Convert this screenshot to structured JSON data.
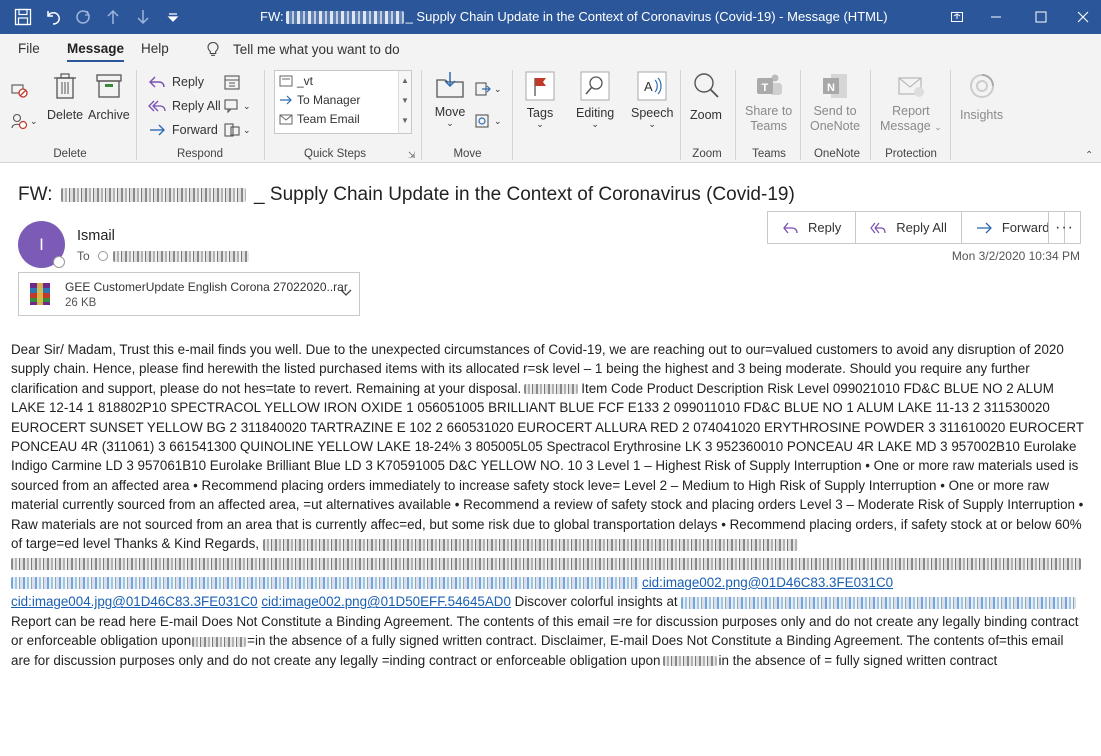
{
  "titlebar": {
    "title_prefix": "FW:",
    "title_suffix": "_ Supply Chain Update in the Context of Coronavirus (Covid-19)  -  Message (HTML)",
    "colors": {
      "bar": "#2b579a"
    }
  },
  "tabs": [
    {
      "label": "File"
    },
    {
      "label": "Message",
      "active": true
    },
    {
      "label": "Help"
    }
  ],
  "tellme": {
    "label": "Tell me what you want to do",
    "icon": "lightbulb-icon"
  },
  "ribbon": {
    "delete": {
      "delete_label": "Delete",
      "archive_label": "Archive",
      "group_label": "Delete"
    },
    "respond": {
      "reply_label": "Reply",
      "reply_all_label": "Reply All",
      "forward_label": "Forward",
      "group_label": "Respond"
    },
    "quick_steps": {
      "items": [
        "_vt",
        "To Manager",
        "Team Email"
      ],
      "group_label": "Quick Steps"
    },
    "move": {
      "move_label": "Move",
      "group_label": "Move"
    },
    "tags": {
      "label": "Tags"
    },
    "editing": {
      "label": "Editing"
    },
    "speech": {
      "label": "Speech"
    },
    "zoom": {
      "label": "Zoom",
      "group_label": "Zoom"
    },
    "teams": {
      "label_line1": "Share to",
      "label_line2": "Teams",
      "group_label": "Teams"
    },
    "onenote": {
      "label_line1": "Send to",
      "label_line2": "OneNote",
      "group_label": "OneNote"
    },
    "protection": {
      "label_line1": "Report",
      "label_line2": "Message",
      "group_label": "Protection"
    },
    "insights": {
      "label": "Insights"
    }
  },
  "message": {
    "subject_prefix": "FW:",
    "subject_suffix": "_ Supply Chain Update in the Context of Coronavirus (Covid-19)",
    "sender_initial": "I",
    "sender_name": "Ismail",
    "to_label": "To",
    "date": "Mon 3/2/2020 10:34 PM",
    "actions": {
      "reply": "Reply",
      "reply_all": "Reply All",
      "forward": "Forward",
      "more": "···"
    },
    "avatar_color": "#7b5bb6",
    "attachment": {
      "name": "GEE CustomerUpdate English Corona 27022020..rar",
      "size": "26 KB"
    }
  },
  "body": {
    "p1": "Dear Sir/ Madam, Trust this e-mail finds you well. Due to the unexpected circumstances of Covid-19, we are reaching out to our=valued customers to avoid any disruption of 2020 supply chain. Hence, please find herewith the listed purchased items with its allocated r=sk level – 1 being the highest and 3 being moderate. Should you require any further clarification and support, please do not hes=tate to revert. Remaining at your disposal.",
    "p2": "Item Code Product Description Risk Level 099021010 FD&C BLUE NO 2 ALUM LAKE 12-14 1 818802P10 SPECTRACOL YELLOW IRON OXIDE 1 056051005 BRILLIANT BLUE FCF E133 2 099011010 FD&C BLUE NO 1 ALUM LAKE 11-13 2 311530020 EUROCERT SUNSET YELLOW BG 2 311840020 TARTRAZINE E 102 2 660531020 EUROCERT ALLURA RED 2 074041020 ERYTHROSINE POWDER 3 311610020 EUROCERT PONCEAU 4R (311061) 3 661541300 QUINOLINE YELLOW LAKE 18-24% 3 805005L05 Spectracol Erythrosine LK 3 952360010 PONCEAU 4R LAKE MD 3 957002B10 Eurolake Indigo Carmine LD 3 957061B10 Eurolake Brilliant Blue LD 3 K70591005 D&C YELLOW NO. 10 3 Level 1 – Highest Risk of Supply Interruption • One or more raw materials used is sourced from an affected area • Recommend placing orders immediately to increase safety stock leve= Level 2 – Medium to High Risk of Supply Interruption • One or more raw material currently sourced from an affected area, =ut alternatives available • Recommend a review of safety stock and placing orders Level 3 – Moderate Risk of Supply Interruption • Raw materials are not sourced from an area that is currently affec=ed, but some risk due to global transportation delays • Recommend placing orders, if safety stock at or below 60% of targe=ed level Thanks & Kind Regards,",
    "link1": "cid:image002.png@01D46C83.3FE031C0",
    "link2": "cid:image004.jpg@01D46C83.3FE031C0",
    "link3": "cid:image002.png@01D50EFF.54645AD0",
    "p3": "Discover colorful insights at",
    "p4": "Report can be read here E-mail Does Not Constitute a Binding Agreement. The contents of this email =re for discussion purposes only and do not create any legally binding contract or enforceable obligation upon",
    "p5": "=in the absence of a fully signed written contract. Disclaimer, E-mail Does Not Constitute a Binding Agreement. The contents of=this email are for discussion purposes only and do not create any legally =inding contract or enforceable obligation upon",
    "p6": "in the absence of = fully signed written contract",
    "link_color": "#1a5fb4"
  }
}
